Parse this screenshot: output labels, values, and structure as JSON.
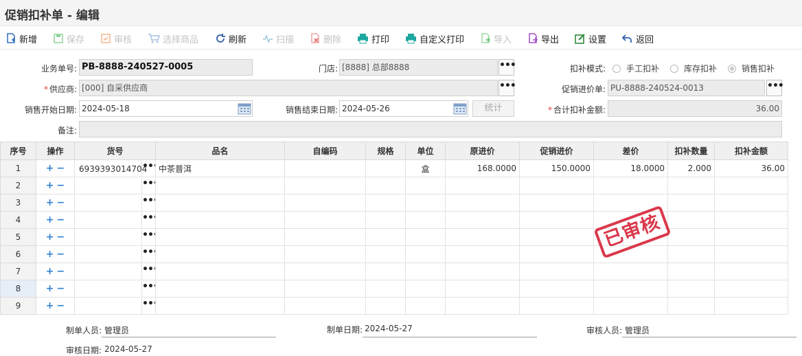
{
  "title": "促销扣补单 - 编辑",
  "toolbar": {
    "new": "新增",
    "save": "保存",
    "audit": "审核",
    "select": "选择商品",
    "refresh": "刷新",
    "scan": "扫描",
    "delete": "删除",
    "print": "打印",
    "custom_print": "自定义打印",
    "import": "导入",
    "export": "导出",
    "settings": "设置",
    "back": "返回"
  },
  "form": {
    "doc_no_label": "业务单号:",
    "doc_no": "PB-8888-240527-0005",
    "store_label": "门店:",
    "store": "[8888] 总部8888",
    "mode_label": "扣补模式:",
    "mode_options": [
      "手工扣补",
      "库存扣补",
      "销售扣补"
    ],
    "supplier_label": "供应商:",
    "supplier": "[000]      自采供应商",
    "promo_in_label": "促销进价单:",
    "promo_in": "PU-8888-240524-0013",
    "start_label": "销售开始日期:",
    "start": "2024-05-18",
    "end_label": "销售结束日期:",
    "end": "2024-05-26",
    "stat_btn": "统计",
    "total_label": "合计扣补金额:",
    "total": "36.00",
    "remark_label": "备注:",
    "remark": "",
    "dots": "•••"
  },
  "grid": {
    "headers": [
      "序号",
      "操作",
      "货号",
      "品名",
      "自编码",
      "规格",
      "单位",
      "原进价",
      "促销进价",
      "差价",
      "扣补数量",
      "扣补金额"
    ],
    "rows": [
      {
        "no": "1",
        "code": "6939393014704",
        "name": "中茶普洱",
        "selfcode": "",
        "spec": "",
        "unit": "盒",
        "orig": "168.0000",
        "promo": "150.0000",
        "diff": "18.0000",
        "qty": "2.000",
        "amount": "36.00"
      },
      {
        "no": "2",
        "code": "",
        "name": "",
        "selfcode": "",
        "spec": "",
        "unit": "",
        "orig": "",
        "promo": "",
        "diff": "",
        "qty": "",
        "amount": ""
      },
      {
        "no": "3",
        "code": "",
        "name": "",
        "selfcode": "",
        "spec": "",
        "unit": "",
        "orig": "",
        "promo": "",
        "diff": "",
        "qty": "",
        "amount": ""
      },
      {
        "no": "4",
        "code": "",
        "name": "",
        "selfcode": "",
        "spec": "",
        "unit": "",
        "orig": "",
        "promo": "",
        "diff": "",
        "qty": "",
        "amount": ""
      },
      {
        "no": "5",
        "code": "",
        "name": "",
        "selfcode": "",
        "spec": "",
        "unit": "",
        "orig": "",
        "promo": "",
        "diff": "",
        "qty": "",
        "amount": ""
      },
      {
        "no": "6",
        "code": "",
        "name": "",
        "selfcode": "",
        "spec": "",
        "unit": "",
        "orig": "",
        "promo": "",
        "diff": "",
        "qty": "",
        "amount": ""
      },
      {
        "no": "7",
        "code": "",
        "name": "",
        "selfcode": "",
        "spec": "",
        "unit": "",
        "orig": "",
        "promo": "",
        "diff": "",
        "qty": "",
        "amount": ""
      },
      {
        "no": "8",
        "code": "",
        "name": "",
        "selfcode": "",
        "spec": "",
        "unit": "",
        "orig": "",
        "promo": "",
        "diff": "",
        "qty": "",
        "amount": ""
      },
      {
        "no": "9",
        "code": "",
        "name": "",
        "selfcode": "",
        "spec": "",
        "unit": "",
        "orig": "",
        "promo": "",
        "diff": "",
        "qty": "",
        "amount": ""
      }
    ],
    "plus": "+",
    "minus": "−"
  },
  "stamp": "已审核",
  "footer": {
    "maker_label": "制单人员:",
    "maker": "管理员",
    "make_date_label": "制单日期:",
    "make_date": "2024-05-27",
    "auditor_label": "审核人员:",
    "auditor": "管理员",
    "audit_date_label": "审核日期:",
    "audit_date": "2024-05-27"
  },
  "colors": {
    "accent": "#2f7fd2",
    "stamp": "#d7283c",
    "disabled": "#c3c3c3"
  }
}
